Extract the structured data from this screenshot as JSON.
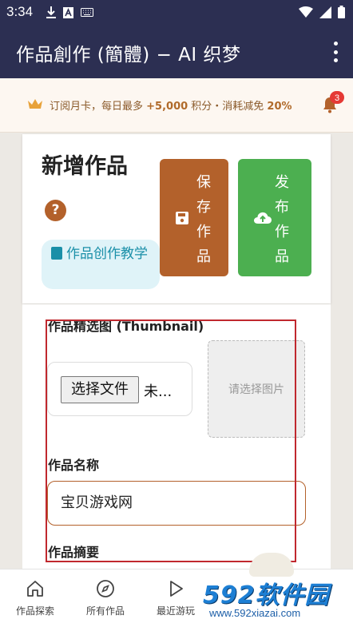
{
  "status_bar": {
    "time": "3:34"
  },
  "app_bar": {
    "title": "作品創作 (簡體) − AI 织梦"
  },
  "promo": {
    "text_prefix": "订阅月卡，每日最多 ",
    "points": "+5,000",
    "text_middle": " 积分・消耗减免 ",
    "discount": "20%",
    "notification_count": "3"
  },
  "header_card": {
    "title": "新增作品",
    "help": "?",
    "tutorial_label": "作品创作教学",
    "save_label": "保存作品",
    "publish_label": "发布作品"
  },
  "form": {
    "thumbnail_label": "作品精选图 (Thumbnail)",
    "file_button": "选择文件",
    "file_status": "未...",
    "preview_placeholder": "请选择图片",
    "name_label": "作品名称",
    "name_value": "宝贝游戏网",
    "summary_label": "作品摘要"
  },
  "bottom_nav": [
    {
      "label": "作品探索",
      "icon": "home-icon"
    },
    {
      "label": "所有作品",
      "icon": "compass-icon"
    },
    {
      "label": "最近游玩",
      "icon": "play-icon"
    }
  ],
  "watermark": {
    "logo": "592软件园",
    "url": "www.592xiazai.com"
  },
  "colors": {
    "app_bar": "#2c2f52",
    "accent_brown": "#b3612b",
    "publish_green": "#4caf50",
    "tutorial_bg": "#dff3f8",
    "badge_red": "#e53935"
  }
}
